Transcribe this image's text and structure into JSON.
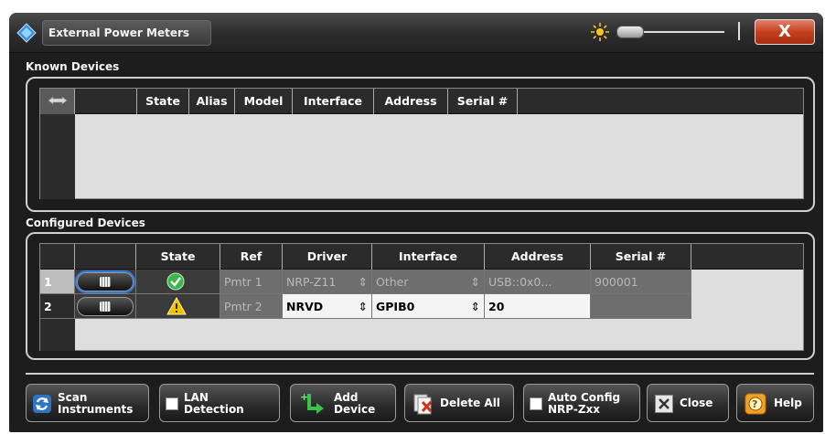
{
  "window": {
    "title": "External Power Meters",
    "close_label": "X"
  },
  "known": {
    "label": "Known Devices",
    "headers": [
      "State",
      "Alias",
      "Model",
      "Interface",
      "Address",
      "Serial #"
    ]
  },
  "configured": {
    "label": "Configured Devices",
    "headers": [
      "State",
      "Ref",
      "Driver",
      "Interface",
      "Address",
      "Serial #"
    ],
    "rows": [
      {
        "num": "1",
        "state": "ok",
        "ref": "Pmtr 1",
        "driver": "NRP-Z11",
        "interface": "Other",
        "address": "USB::0x0...",
        "serial": "900001"
      },
      {
        "num": "2",
        "state": "warning",
        "ref": "Pmtr 2",
        "driver": "NRVD",
        "interface": "GPIB0",
        "address": "20",
        "serial": ""
      }
    ]
  },
  "buttons": {
    "scan": "Scan\nInstruments",
    "lan": "LAN\nDetection",
    "add": "Add\nDevice",
    "delete_all": "Delete All",
    "auto_config": "Auto Config\nNRP-Zxx",
    "close": "Close",
    "help": "Help"
  },
  "colors": {
    "accent_red": "#c4411f",
    "focus_blue": "#2f7be0",
    "ok_green": "#3cb54a",
    "warn_yellow": "#f2c200"
  }
}
